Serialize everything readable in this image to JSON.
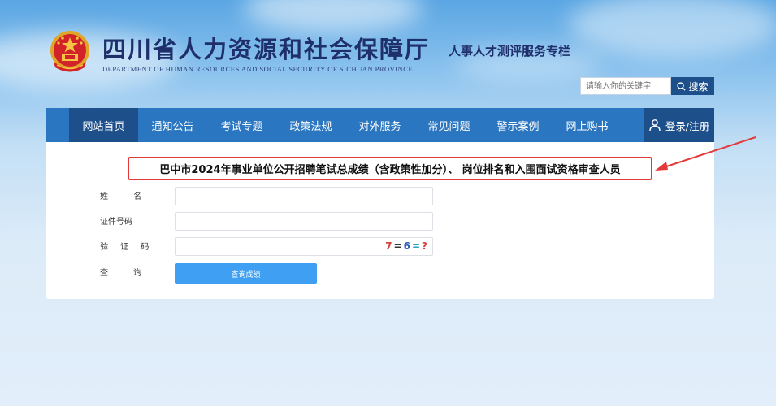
{
  "header": {
    "site_title": "四川省人力资源和社会保障厅",
    "site_subtitle": "DEPARTMENT OF HUMAN RESOURCES AND SOCIAL SECURITY OF SICHUAN PROVINCE",
    "column_name": "人事人才测评服务专栏"
  },
  "search": {
    "placeholder": "请输入你的关键字",
    "button_label": "搜索"
  },
  "nav": {
    "items": [
      {
        "label": "网站首页"
      },
      {
        "label": "通知公告"
      },
      {
        "label": "考试专题"
      },
      {
        "label": "政策法规"
      },
      {
        "label": "对外服务"
      },
      {
        "label": "常见问题"
      },
      {
        "label": "警示案例"
      },
      {
        "label": "网上购书"
      }
    ],
    "login_label": "登录/注册"
  },
  "notice": {
    "title": "巴中市2024年事业单位公开招聘笔试总成绩（含政策性加分）、 岗位排名和入围面试资格审查人员"
  },
  "form": {
    "name_label": "姓 名",
    "id_label": "证件号码",
    "captcha_label": "验 证 码",
    "query_label": "查 询",
    "captcha_text": [
      "7",
      "=",
      "6",
      "=",
      "?"
    ],
    "submit_label": "查询成绩"
  },
  "colors": {
    "nav_bg": "#2b76c0",
    "nav_active": "#1d4f8a",
    "highlight_border": "#e23a3a",
    "button_bg": "#3f9ff2",
    "title_color": "#1e2f6b"
  }
}
